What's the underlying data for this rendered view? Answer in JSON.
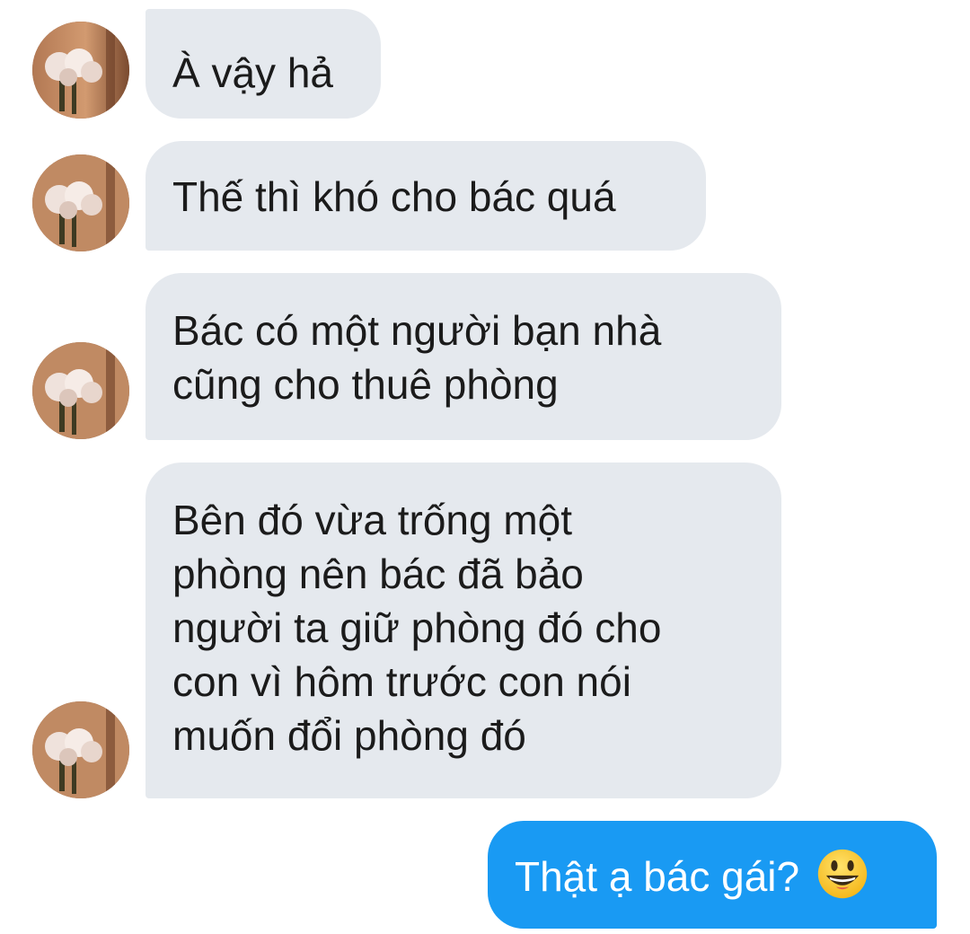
{
  "conversation": {
    "messages": [
      {
        "direction": "incoming",
        "text": "À vậy hả"
      },
      {
        "direction": "incoming",
        "text": "Thế thì khó cho bác quá"
      },
      {
        "direction": "incoming",
        "text": "Bác có một người bạn nhà\ncũng cho thuê phòng"
      },
      {
        "direction": "incoming",
        "text": "Bên đó vừa trống một\nphòng nên bác đã bảo\nngười ta giữ phòng đó cho\ncon vì hôm trước con nói\nmuốn đổi phòng đó"
      },
      {
        "direction": "outgoing",
        "text": "Thật ạ bác gái?",
        "emoji": "grinning-face-emoji"
      }
    ]
  },
  "colors": {
    "incoming_bubble": "#e5e9ee",
    "outgoing_bubble": "#199af3",
    "incoming_text": "#1b1b1b",
    "outgoing_text": "#ffffff"
  },
  "avatar": {
    "icon": "flower-bouquet-avatar"
  }
}
